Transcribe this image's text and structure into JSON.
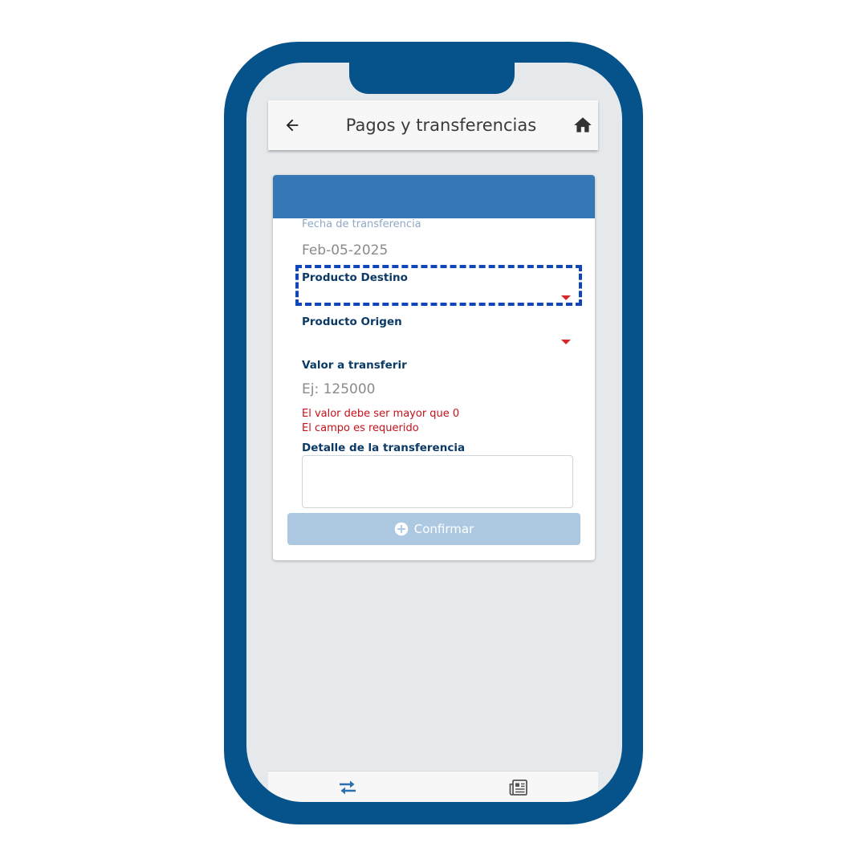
{
  "header": {
    "title": "Pagos y transferencias"
  },
  "form": {
    "date_label": "Fecha de transferencia",
    "date_value": "Feb-05-2025",
    "destination_label": "Producto Destino",
    "origin_label": "Producto Origen",
    "amount_label": "Valor a transferir",
    "amount_placeholder": "Ej: 125000",
    "errors": [
      "El valor debe ser mayor que 0",
      "El campo es requerido"
    ],
    "detail_label": "Detalle de la transferencia",
    "confirm_label": "Confirmar"
  },
  "icons": {
    "back": "arrow-left-icon",
    "home": "home-icon",
    "confirm": "plus-circle-icon",
    "nav_transfers": "transfer-arrows-icon",
    "nav_news": "newspaper-icon"
  },
  "colors": {
    "phone_frame": "#06528a",
    "card_header": "#3578b5",
    "field_label": "#0b3a66",
    "error": "#c8101a",
    "dropdown_arrow": "#d62828",
    "confirm_disabled": "#adc9e2",
    "highlight": "#0f47b8"
  }
}
